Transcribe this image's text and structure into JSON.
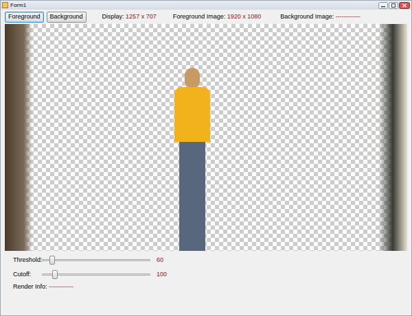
{
  "window": {
    "title": "Form1"
  },
  "toolbar": {
    "buttons": [
      {
        "label": "Foreground",
        "selected": true
      },
      {
        "label": "Background",
        "selected": false
      }
    ],
    "info": [
      {
        "label": "Display:",
        "value": "1257 x 707"
      },
      {
        "label": "Foreground Image:",
        "value": "1920 x 1080"
      },
      {
        "label": "Background Image:",
        "value": "------------"
      }
    ]
  },
  "sliders": [
    {
      "label": "Threshold:",
      "level": 0.07,
      "reading": "60"
    },
    {
      "label": "Cutoff:",
      "level": 0.1,
      "reading": "100"
    }
  ],
  "render_info": {
    "label": "Render Info:",
    "value": "------------"
  }
}
